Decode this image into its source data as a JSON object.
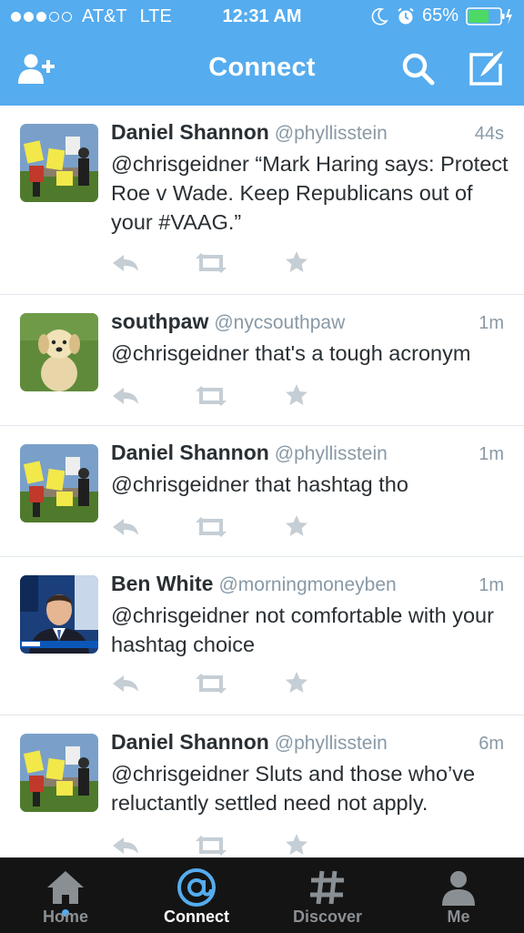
{
  "colors": {
    "accent": "#55acee",
    "tabbar": "#141414",
    "battery": "#4cd964"
  },
  "status_bar": {
    "signal_dots": [
      true,
      true,
      true,
      false,
      false
    ],
    "carrier": "AT&T",
    "network": "LTE",
    "time": "12:31 AM",
    "battery_percent": "65%",
    "battery_level": 0.65
  },
  "nav": {
    "title": "Connect",
    "icons": [
      "add-user-icon",
      "search-icon",
      "compose-icon"
    ]
  },
  "tweets": [
    {
      "name": "Daniel Shannon",
      "handle": "@phyllisstein",
      "time": "44s",
      "text": "@chrisgeidner “Mark Haring says: Protect Roe v Wade. Keep Republicans out of your #VAAG.”",
      "avatar": "protest-photo"
    },
    {
      "name": "southpaw",
      "handle": "@nycsouthpaw",
      "time": "1m",
      "text": "@chrisgeidner that's a tough acronym",
      "avatar": "puppy-photo"
    },
    {
      "name": "Daniel Shannon",
      "handle": "@phyllisstein",
      "time": "1m",
      "text": "@chrisgeidner that hashtag tho",
      "avatar": "protest-photo"
    },
    {
      "name": "Ben White",
      "handle": "@morningmoneyben",
      "time": "1m",
      "text": "@chrisgeidner not comfortable with your hashtag choice",
      "avatar": "tv-anchor-photo"
    },
    {
      "name": "Daniel Shannon",
      "handle": "@phyllisstein",
      "time": "6m",
      "text": "@chrisgeidner Sluts and those who’ve reluctantly settled need not apply.",
      "avatar": "protest-photo"
    }
  ],
  "tabbar": {
    "tabs": [
      {
        "label": "Home",
        "icon": "house-icon",
        "active": false
      },
      {
        "label": "Connect",
        "icon": "at-sign-icon",
        "active": true
      },
      {
        "label": "Discover",
        "icon": "hashtag-icon",
        "active": false
      },
      {
        "label": "Me",
        "icon": "person-icon",
        "active": false
      }
    ]
  }
}
